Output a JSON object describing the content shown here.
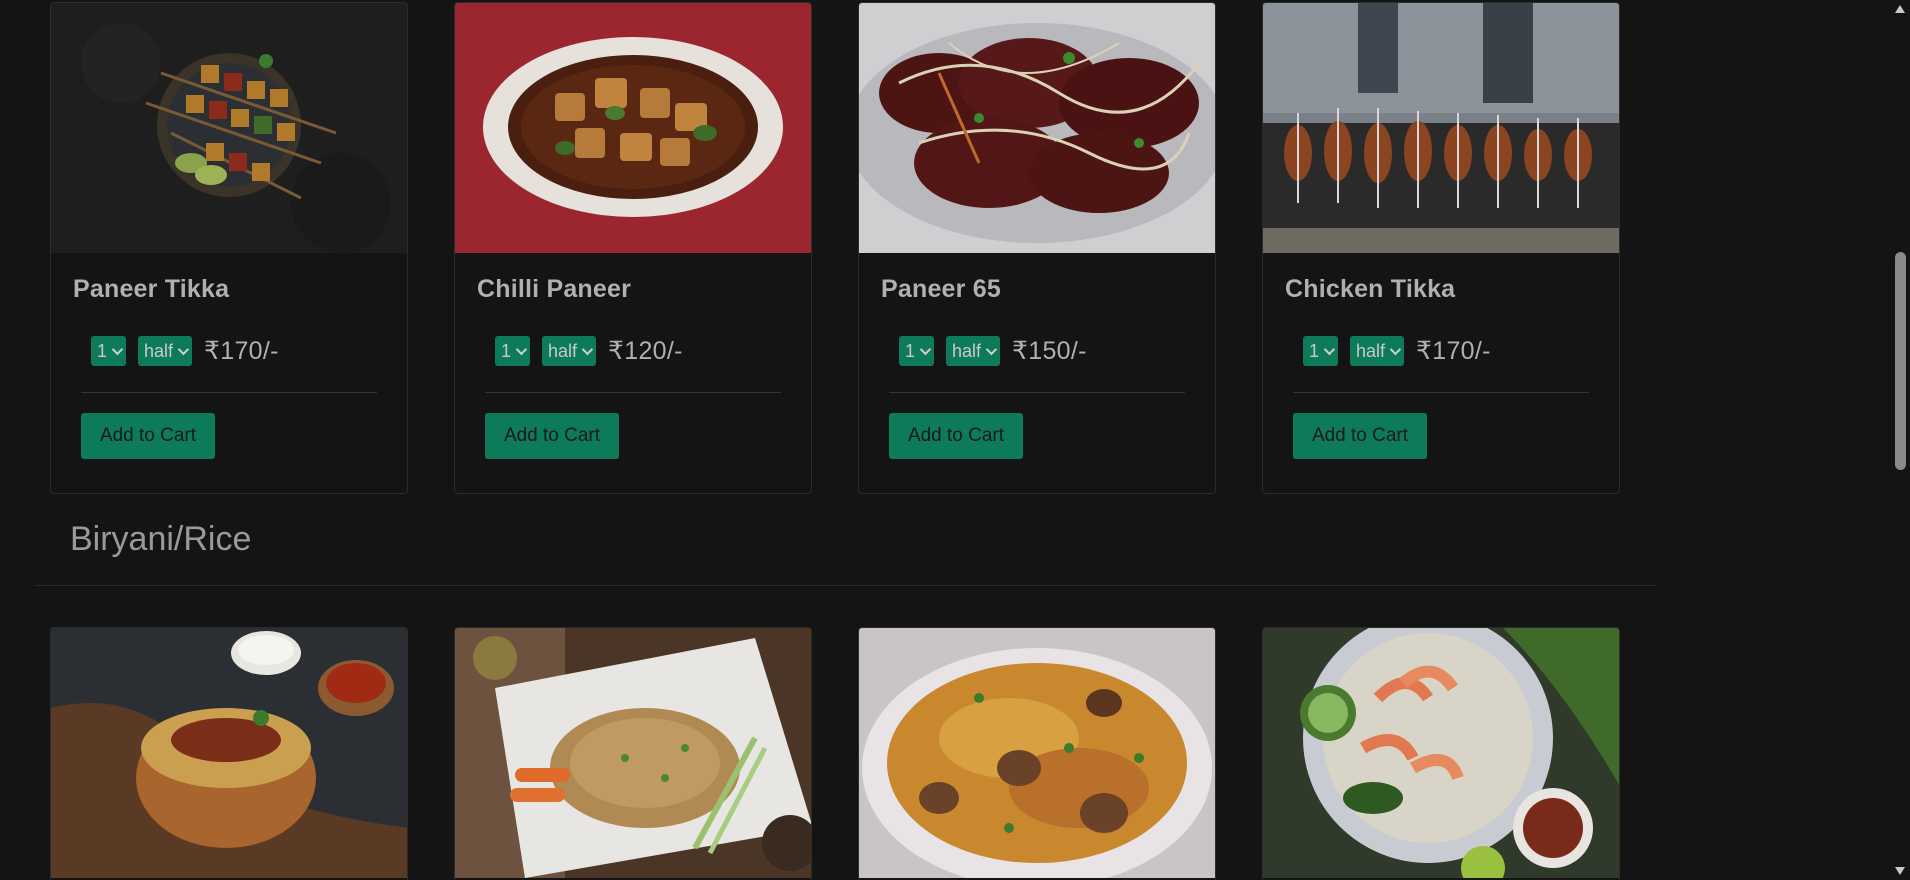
{
  "top_row": [
    {
      "name": "Paneer Tikka",
      "qty": "1",
      "size": "half",
      "price": "₹170/-",
      "button": "Add to Cart",
      "image_icon": "paneer-tikka-image"
    },
    {
      "name": "Chilli Paneer",
      "qty": "1",
      "size": "half",
      "price": "₹120/-",
      "button": "Add to Cart",
      "image_icon": "chilli-paneer-image"
    },
    {
      "name": "Paneer 65",
      "qty": "1",
      "size": "half",
      "price": "₹150/-",
      "button": "Add to Cart",
      "image_icon": "paneer-65-image"
    },
    {
      "name": "Chicken Tikka",
      "qty": "1",
      "size": "half",
      "price": "₹170/-",
      "button": "Add to Cart",
      "image_icon": "chicken-tikka-image"
    }
  ],
  "section": {
    "title": "Biryani/Rice"
  },
  "bottom_row": [
    {
      "image_icon": "biryani-bowl-image"
    },
    {
      "image_icon": "fried-rice-plate-image"
    },
    {
      "image_icon": "chicken-biryani-image"
    },
    {
      "image_icon": "prawn-fried-rice-image"
    }
  ],
  "colors": {
    "background": "#141414",
    "accent": "#0d7b5a",
    "text": "#b0b0b0"
  }
}
